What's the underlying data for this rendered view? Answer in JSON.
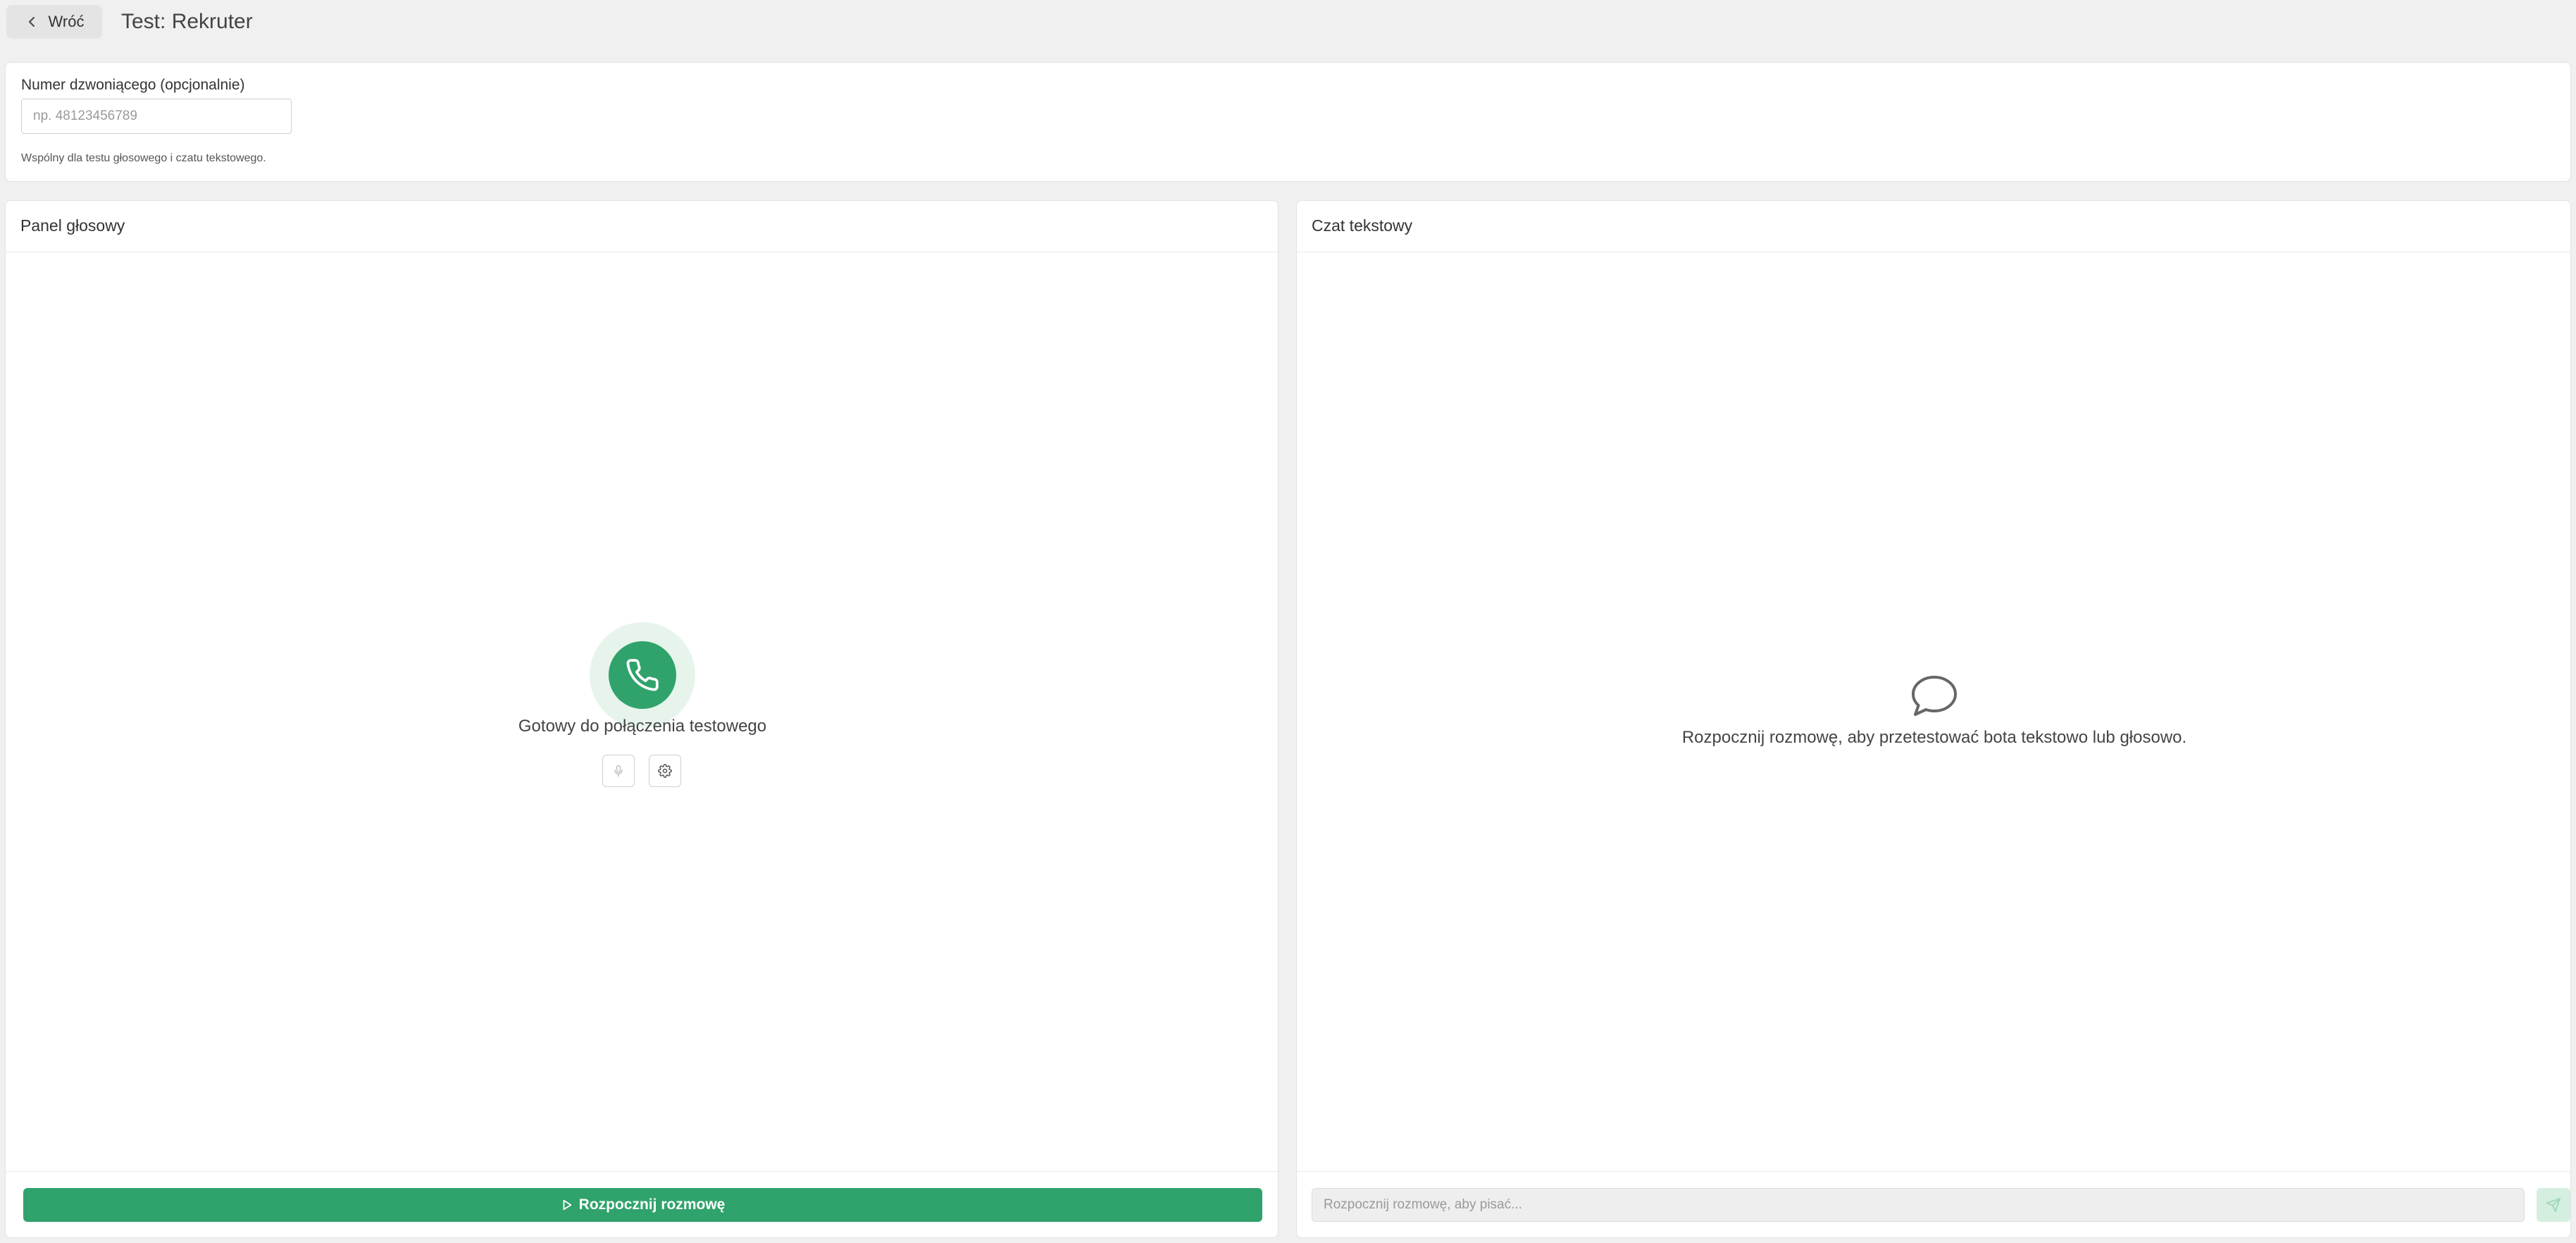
{
  "header": {
    "back_label": "Wróć",
    "title": "Test: Rekruter"
  },
  "caller": {
    "label": "Numer dzwoniącego (opcjonalnie)",
    "placeholder": "np. 48123456789",
    "value": "",
    "hint": "Wspólny dla testu głosowego i czatu tekstowego."
  },
  "voice_panel": {
    "title": "Panel głosowy",
    "status": "Gotowy do połączenia testowego",
    "start_label": "Rozpocznij rozmowę",
    "icons": {
      "main": "phone-icon",
      "mic": "microphone-icon",
      "settings": "gear-icon",
      "start": "play-icon"
    }
  },
  "chat_panel": {
    "title": "Czat tekstowy",
    "empty_message": "Rozpocznij rozmowę, aby przetestować bota tekstowo lub głosowo.",
    "input_placeholder": "Rozpocznij rozmowę, aby pisać...",
    "icons": {
      "empty": "chat-bubble-icon",
      "send": "send-icon"
    }
  },
  "colors": {
    "accent": "#2fa36b",
    "accent_light": "#e6f4ec",
    "send_disabled": "#d4efdf",
    "background": "#f0f0f0"
  }
}
